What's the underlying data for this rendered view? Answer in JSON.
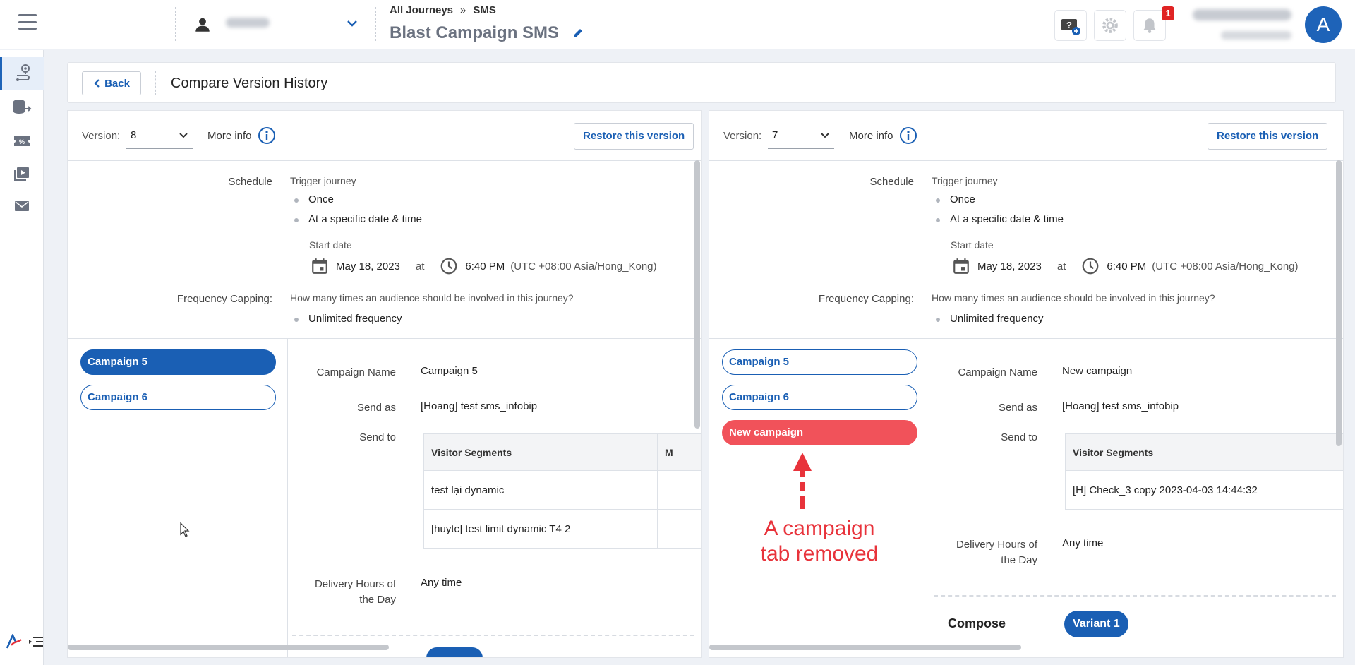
{
  "topbar": {
    "breadcrumb_root": "All Journeys",
    "breadcrumb_sep": "»",
    "breadcrumb_current": "SMS",
    "title": "Blast Campaign SMS",
    "notification_count": "1",
    "avatar_letter": "A"
  },
  "header": {
    "back_label": "Back",
    "title": "Compare Version History"
  },
  "left": {
    "version_label": "Version:",
    "version_value": "8",
    "more_info": "More info",
    "restore_label": "Restore this version",
    "schedule_label": "Schedule",
    "trigger_label": "Trigger journey",
    "trigger_once": "Once",
    "trigger_specific": "At a specific date & time",
    "start_date_label": "Start date",
    "start_date": "May 18, 2023",
    "at": "at",
    "start_time": "6:40 PM",
    "timezone": "(UTC +08:00 Asia/Hong_Kong)",
    "freq_label": "Frequency Capping:",
    "freq_question": "How many times an audience should be involved in this journey?",
    "freq_value": "Unlimited frequency",
    "campaigns": [
      "Campaign 5",
      "Campaign 6"
    ],
    "campaign_name_label": "Campaign Name",
    "campaign_name": "Campaign 5",
    "send_as_label": "Send as",
    "send_as": "[Hoang] test sms_infobip",
    "send_to_label": "Send to",
    "segments_header": "Visitor Segments",
    "segments_header2": "M",
    "segments": [
      "test lại dynamic",
      "[huytc] test limit dynamic T4 2"
    ],
    "delivery_label": "Delivery Hours of the Day",
    "delivery_value": "Any time"
  },
  "right": {
    "version_label": "Version:",
    "version_value": "7",
    "more_info": "More info",
    "restore_label": "Restore this version",
    "schedule_label": "Schedule",
    "trigger_label": "Trigger journey",
    "trigger_once": "Once",
    "trigger_specific": "At a specific date & time",
    "start_date_label": "Start date",
    "start_date": "May 18, 2023",
    "at": "at",
    "start_time": "6:40 PM",
    "timezone": "(UTC +08:00 Asia/Hong_Kong)",
    "freq_label": "Frequency Capping:",
    "freq_question": "How many times an audience should be involved in this journey?",
    "freq_value": "Unlimited frequency",
    "campaigns": [
      "Campaign 5",
      "Campaign 6",
      "New campaign"
    ],
    "campaign_name_label": "Campaign Name",
    "campaign_name": "New campaign",
    "send_as_label": "Send as",
    "send_as": "[Hoang] test sms_infobip",
    "send_to_label": "Send to",
    "segments_header": "Visitor Segments",
    "segments": [
      "[H] Check_3 copy 2023-04-03 14:44:32"
    ],
    "delivery_label": "Delivery Hours of the Day",
    "delivery_value": "Any time",
    "compose_label": "Compose",
    "variant_label": "Variant 1"
  },
  "annotation": {
    "line1": "A campaign",
    "line2": "tab removed",
    "color": "#e8333b"
  },
  "icons": {
    "menu": "hamburger-icon",
    "account": "person-icon",
    "edit": "pencil-icon",
    "help": "help-ticket-icon",
    "settings": "gear-icon",
    "notifications": "bell-icon",
    "info": "info-icon",
    "calendar": "calendar-icon",
    "clock": "clock-icon"
  },
  "colors": {
    "primary": "#1a5fb4",
    "removed": "#f1525a",
    "badge": "#e02424"
  }
}
